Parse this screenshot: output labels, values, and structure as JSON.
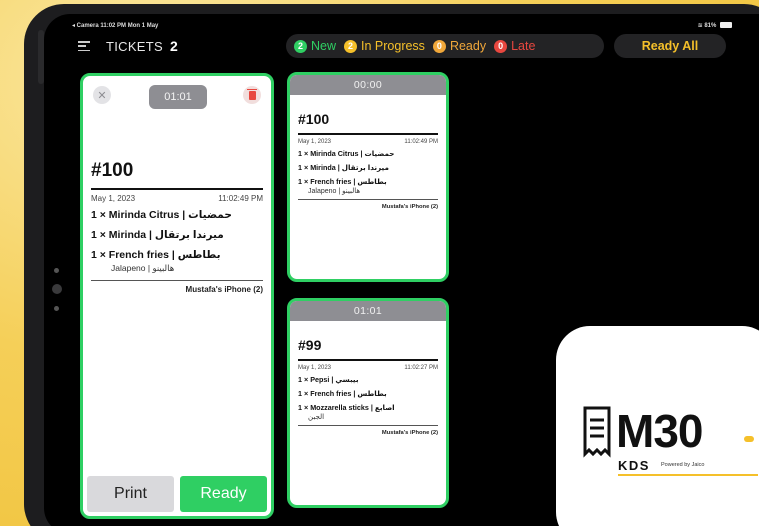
{
  "statusbar": {
    "left": "◂ Camera  11:02 PM  Mon 1 May",
    "right": "≋ 81%"
  },
  "header": {
    "tickets_label": "TICKETS",
    "tickets_count": "2",
    "filters": [
      {
        "count": "2",
        "label": "New",
        "color": "#2fcf63"
      },
      {
        "count": "2",
        "label": "In Progress",
        "color": "#f5c02a"
      },
      {
        "count": "0",
        "label": "Ready",
        "color": "#f0a73a"
      },
      {
        "count": "0",
        "label": "Late",
        "color": "#e8473f"
      }
    ],
    "ready_all_label": "Ready All"
  },
  "focused_ticket": {
    "close_glyph": "✕",
    "timer": "01:01",
    "order_no": "#100",
    "date": "May 1, 2023",
    "time": "11:02:49 PM",
    "items": [
      {
        "text": "1 × Mirinda Citrus | حمضيات"
      },
      {
        "text": "1 × Mirinda | ميرندا برتقال"
      },
      {
        "text": "1 × French fries | بطاطس"
      }
    ],
    "modifier": "Jalapeno | هالبينو",
    "device": "Mustafa's iPhone (2)",
    "print_label": "Print",
    "ready_label": "Ready"
  },
  "tickets": [
    {
      "timer": "00:00",
      "order_no": "#100",
      "date": "May 1, 2023",
      "time": "11:02:49 PM",
      "items": [
        "1 × Mirinda Citrus | حمضيات",
        "1 × Mirinda | ميرندا برتقال",
        "1 × French fries | بطاطس"
      ],
      "modifier": "Jalapeno | هالبينو",
      "device": "Mustafa's iPhone (2)"
    },
    {
      "timer": "01:01",
      "order_no": "#99",
      "date": "May 1, 2023",
      "time": "11:02:27 PM",
      "items": [
        "1 × Pepsi | بيبسي",
        "1 × French fries | بطاطس",
        "1 × Mozzarella sticks | اصابع"
      ],
      "modifier": "الجبن",
      "device": "Mustafa's iPhone (2)"
    }
  ],
  "logo": {
    "wordmark": "M30",
    "kds": "KDS",
    "powered": "Powered by Jaico"
  }
}
